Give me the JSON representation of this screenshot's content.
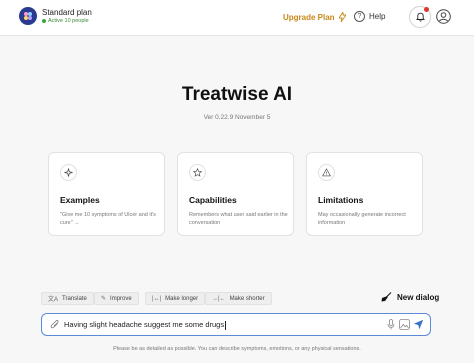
{
  "header": {
    "plan_name": "Standard plan",
    "plan_status": "Active 10 people",
    "upgrade_label": "Upgrade Plan",
    "help_label": "Help"
  },
  "main": {
    "title": "Treatwise AI",
    "version": "Ver 0.22.9 November 5"
  },
  "cards": [
    {
      "icon": "sparkle-icon",
      "title": "Examples",
      "desc": "\"Give me 10 symptoms of Ulcer and it's cure\" →"
    },
    {
      "icon": "star-icon",
      "title": "Capabilities",
      "desc": "Remembers what user said earlier in the conversation"
    },
    {
      "icon": "warning-icon",
      "title": "Limitations",
      "desc": "May occasionally generate incorrect information"
    }
  ],
  "actions": {
    "translate": "Translate",
    "improve": "Improve",
    "make_longer": "Make longer",
    "make_shorter": "Make shorter",
    "new_dialog": "New dialog"
  },
  "input": {
    "value": "Having slight headache suggest me some drugs"
  },
  "footer": "Please be as detailed as possible. You can describe symptoms, emotions, or any physical sensations.",
  "colors": {
    "accent": "#5b8ad6",
    "upgrade": "#c8881a",
    "status": "#3ea53e",
    "notification": "#e0342b"
  }
}
